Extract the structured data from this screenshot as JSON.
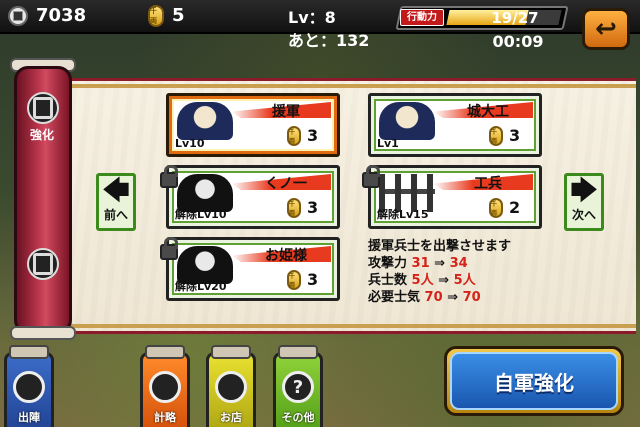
{
  "status": {
    "money": "7038",
    "coins": "5",
    "level": "Lv：8",
    "remaining": "あと：132",
    "action_label": "行動力",
    "action_text": "19/27",
    "action_fill": 0.7037,
    "timer": "00:09"
  },
  "coin_glyph": "千両",
  "side": {
    "upgrade_label": "強化"
  },
  "units": [
    {
      "name": "援軍",
      "sub": "Lv10",
      "cost": "3"
    },
    {
      "name": "城大工",
      "sub": "Lv1",
      "cost": "3"
    },
    {
      "name": "くノ一",
      "sub": "解除Lv10",
      "cost": "3"
    },
    {
      "name": "工兵",
      "sub": "解除Lv15",
      "cost": "2"
    },
    {
      "name": "お姫様",
      "sub": "解除Lv20",
      "cost": "3"
    }
  ],
  "nav": {
    "prev_label": "前へ",
    "next_label": "次へ",
    "prev_arrow": "🡄",
    "next_arrow": "🡆"
  },
  "info": {
    "description": "援軍兵士を出撃させます",
    "attack_label": "攻撃力",
    "attack_from": "31",
    "attack_to": "34",
    "soldiers_label": "兵士数",
    "soldiers_from": "5人",
    "soldiers_to": "5人",
    "morale_label": "必要士気",
    "morale_from": "70",
    "morale_to": "70",
    "arrow": "⇒"
  },
  "tabs": [
    {
      "label": "出陣"
    },
    {
      "label": "計略"
    },
    {
      "label": "お店"
    },
    {
      "label": "その他"
    }
  ],
  "big_button": "自軍強化",
  "back_arrow": "↩",
  "colors": {
    "accent_red": "#d4231a",
    "button_blue": "#1a56b0",
    "card_border_green": "#3c8a1c"
  }
}
